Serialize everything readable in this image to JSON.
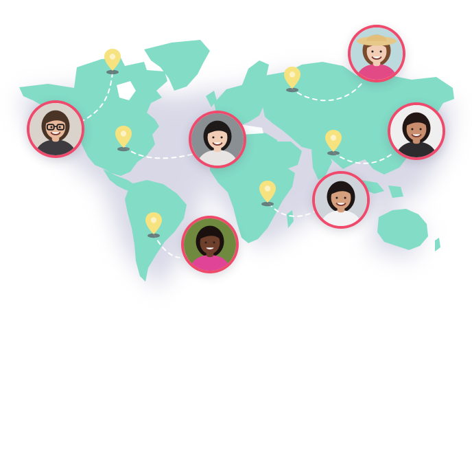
{
  "colors": {
    "land": "#83dcc6",
    "pin": "#f6e37f",
    "pin_shadow": "#5f6f70",
    "ring": "#ef4a6c",
    "dash": "#ffffff",
    "glow": "#c9c9df"
  },
  "icons": {
    "pin": "map-pin-icon",
    "avatar": "person-avatar"
  },
  "people": [
    {
      "id": "man-glasses",
      "skin": "#e8b89a",
      "hair": "#4a3426",
      "shirt": "#3d3b3f",
      "bg": "#d9d3cc",
      "glasses": true,
      "hat": false
    },
    {
      "id": "woman-smiling-center",
      "skin": "#f1cdb5",
      "hair": "#1e1a1a",
      "shirt": "#e9e4e4",
      "bg": "#8a8f94",
      "glasses": false,
      "hat": false
    },
    {
      "id": "woman-hat",
      "skin": "#f2cdb6",
      "hair": "#7a4b2d",
      "shirt": "#e24a86",
      "bg": "#bcd9dd",
      "glasses": false,
      "hat": true
    },
    {
      "id": "woman-right",
      "skin": "#c98e6d",
      "hair": "#221714",
      "shirt": "#2e2b2f",
      "bg": "#efeff0",
      "glasses": false,
      "hat": false
    },
    {
      "id": "man-center-right",
      "skin": "#d6a07f",
      "hair": "#1d1614",
      "shirt": "#f3f3f6",
      "bg": "#cfd4db",
      "glasses": false,
      "hat": false
    },
    {
      "id": "woman-bottom",
      "skin": "#6e3f2b",
      "hair": "#1a110e",
      "shirt": "#e04497",
      "bg": "#6f8a3e",
      "glasses": false,
      "hat": false
    }
  ]
}
